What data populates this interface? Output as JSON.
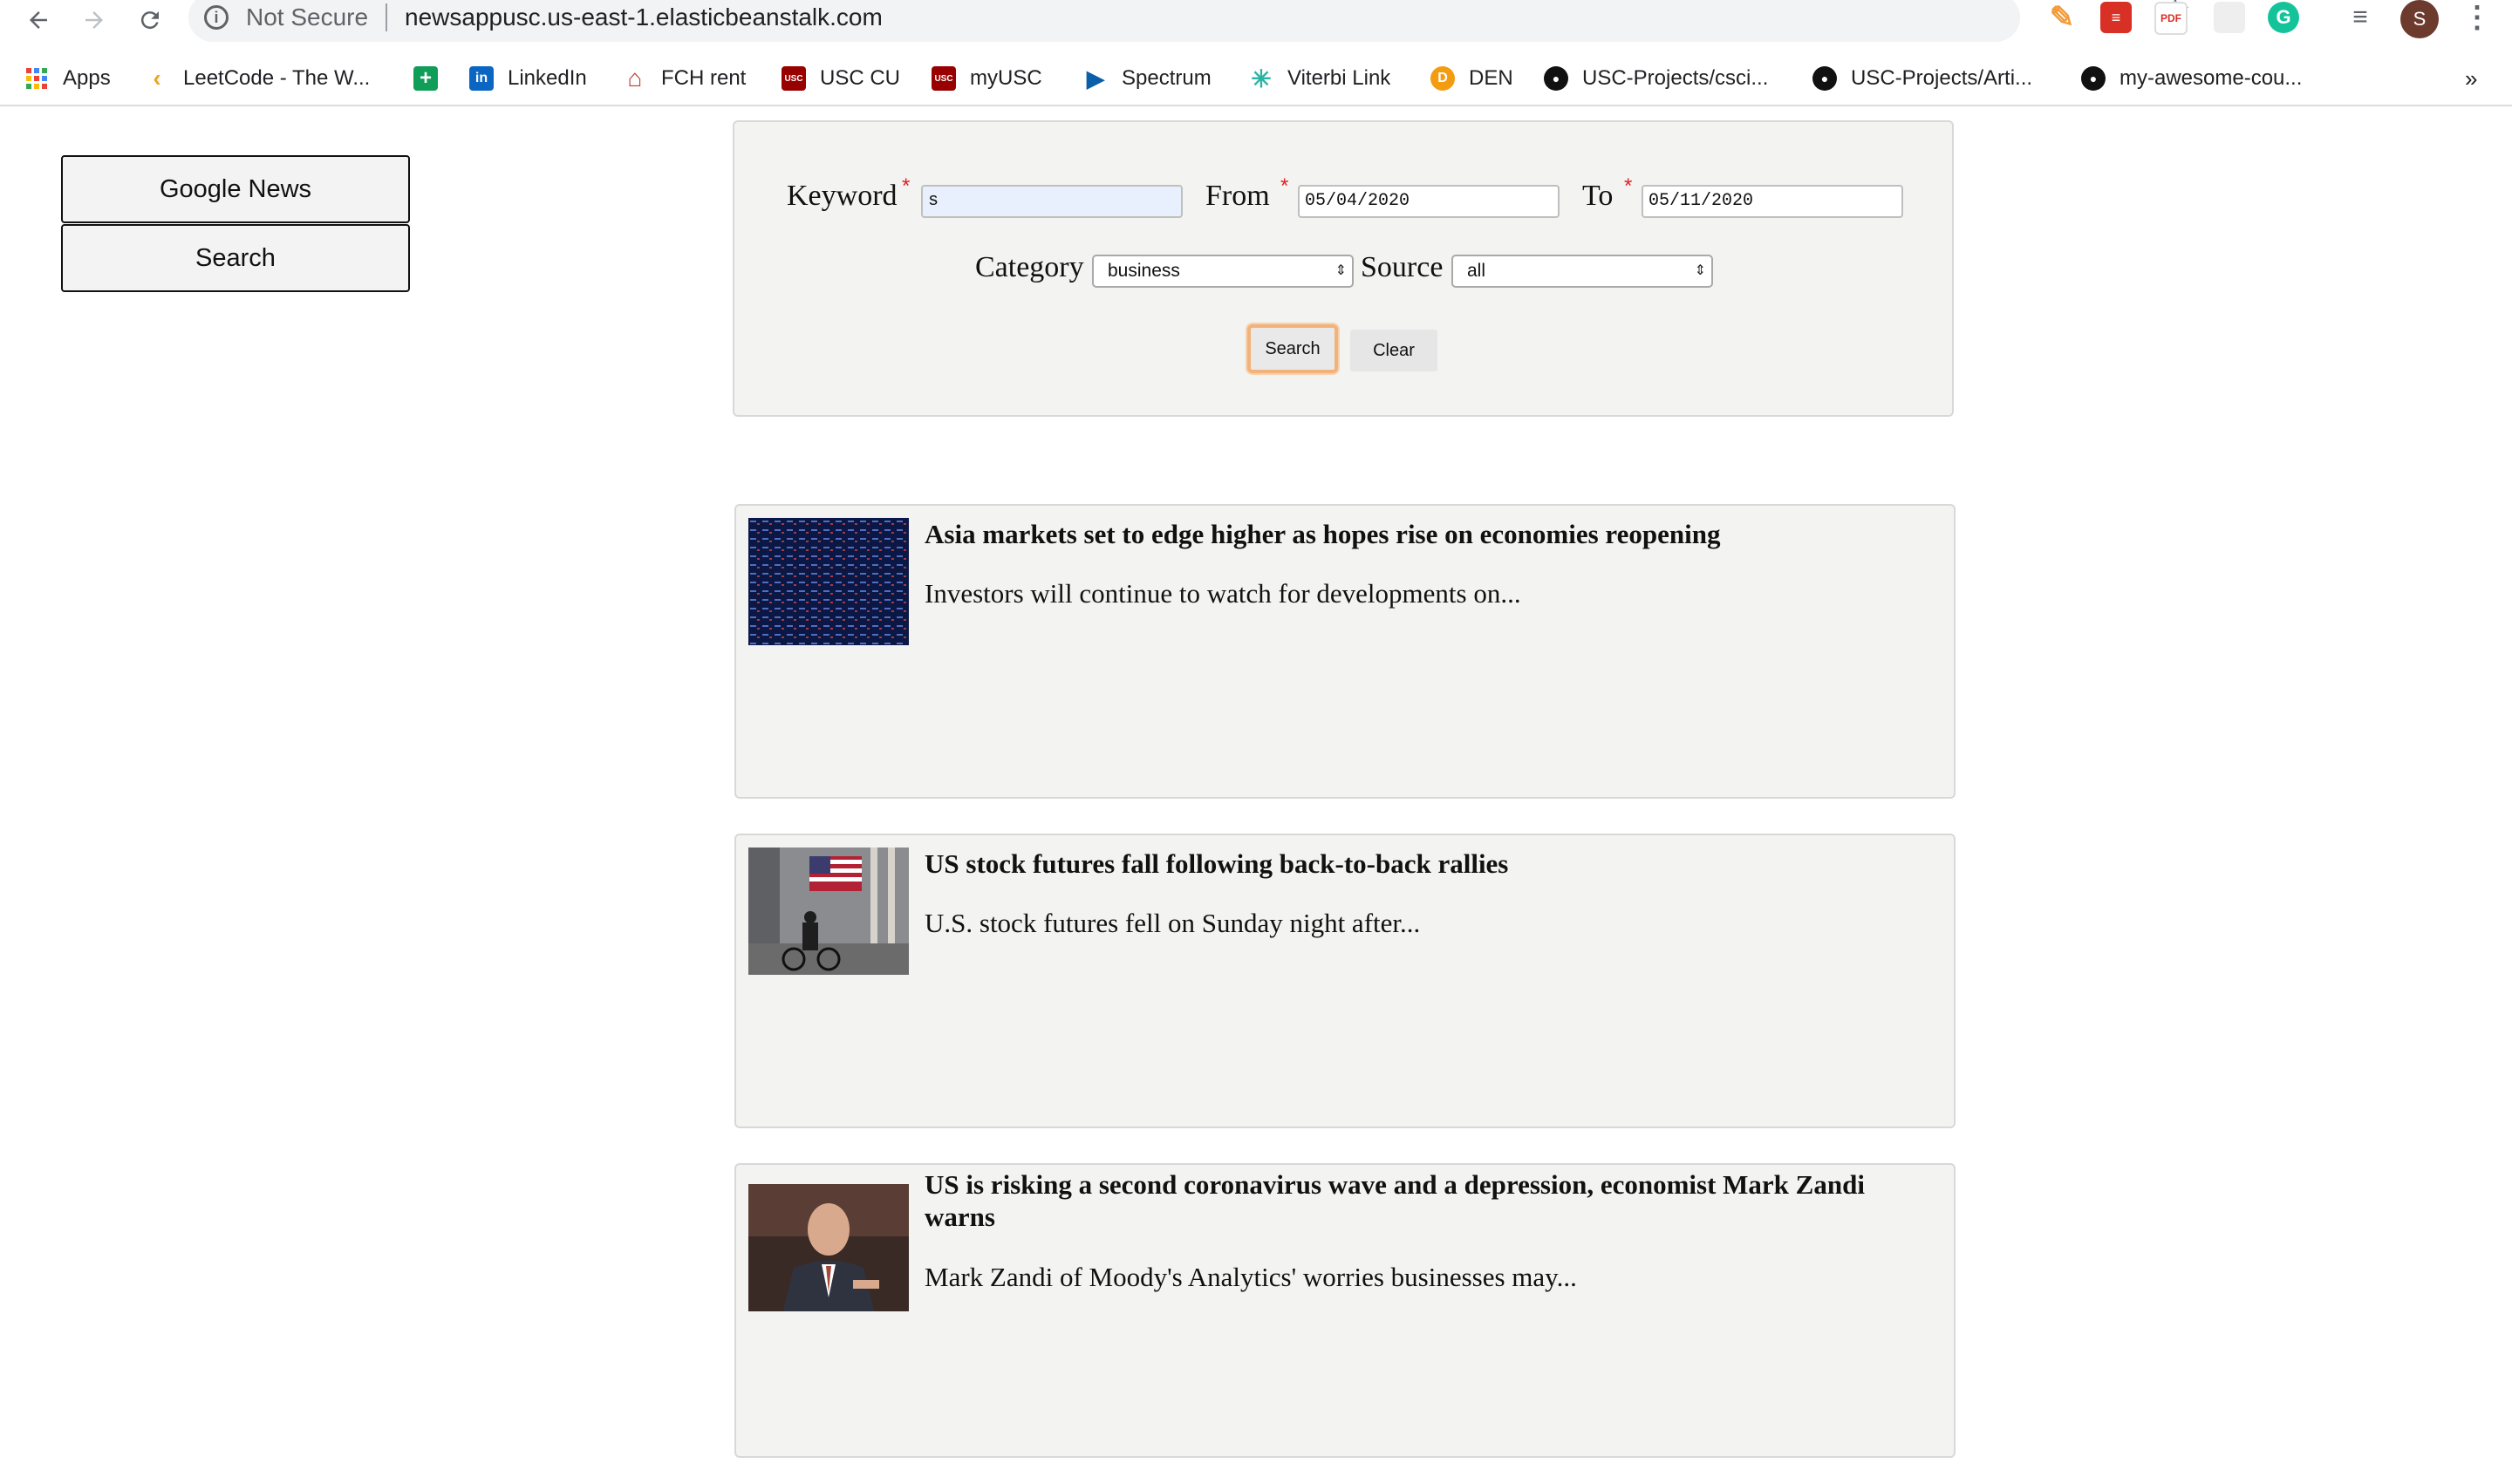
{
  "browser": {
    "security_label": "Not Secure",
    "url": "newsappusc.us-east-1.elasticbeanstalk.com",
    "profile_initial": "S",
    "bookmarks": [
      {
        "label": "Apps",
        "icon": "apps-grid-icon"
      },
      {
        "label": "LeetCode - The W...",
        "icon": "leetcode-icon"
      },
      {
        "label": "",
        "icon": "google-sheets-icon"
      },
      {
        "label": "LinkedIn",
        "icon": "linkedin-icon"
      },
      {
        "label": "FCH rent",
        "icon": "house-icon"
      },
      {
        "label": "USC CU",
        "icon": "usc-cu-icon"
      },
      {
        "label": "myUSC",
        "icon": "usc-icon"
      },
      {
        "label": "Spectrum",
        "icon": "play-icon"
      },
      {
        "label": "Viterbi Link",
        "icon": "viterbi-icon"
      },
      {
        "label": "DEN",
        "icon": "den-icon"
      },
      {
        "label": "USC-Projects/csci...",
        "icon": "github-icon"
      },
      {
        "label": "USC-Projects/Arti...",
        "icon": "github-icon"
      },
      {
        "label": "my-awesome-cou...",
        "icon": "github-icon"
      }
    ],
    "more_bookmarks": "»"
  },
  "sidebar": {
    "google_news_label": "Google News",
    "search_label": "Search"
  },
  "form": {
    "keyword_label": "Keyword",
    "keyword_value": "s",
    "from_label": "From",
    "from_value": "05/04/2020",
    "to_label": "To",
    "to_value": "05/11/2020",
    "required_mark": "*",
    "category_label": "Category",
    "category_value": "business",
    "source_label": "Source",
    "source_value": "all",
    "search_button": "Search",
    "clear_button": "Clear"
  },
  "articles": [
    {
      "title": "Asia markets set to edge higher as hopes rise on economies reopening",
      "description": "Investors will continue to watch for developments on..."
    },
    {
      "title": "US stock futures fall following back-to-back rallies",
      "description": "U.S. stock futures fell on Sunday night after..."
    },
    {
      "title": "US is risking a second coronavirus wave and a depression, economist Mark Zandi warns",
      "description": "Mark Zandi of Moody's Analytics' worries businesses may..."
    }
  ],
  "colors": {
    "required": "#e02020",
    "focus_outline": "#f3b27a",
    "panel_bg": "#f3f3f2"
  }
}
